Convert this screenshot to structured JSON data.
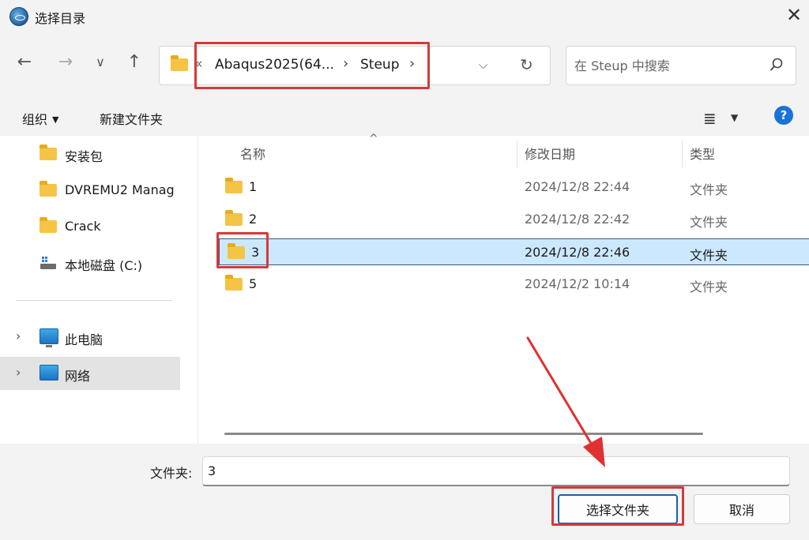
{
  "window": {
    "title": "选择目录",
    "close_glyph": "✕"
  },
  "nav": {
    "back": "←",
    "forward": "→",
    "recent": "∨",
    "up": "↑"
  },
  "address": {
    "overflow": "«",
    "segments": [
      "Abaqus2025(64...",
      "Steup"
    ],
    "separator": "›",
    "dropdown": "⌵",
    "refresh": "↻"
  },
  "search": {
    "placeholder": "在 Steup 中搜索"
  },
  "toolbar": {
    "organize": "组织",
    "organize_arrow": "▼",
    "new_folder": "新建文件夹",
    "view_icon": "≣",
    "view_arrow": "▼",
    "help": "?"
  },
  "sidebar": {
    "items": [
      {
        "label": "安装包",
        "icon": "folder-icon"
      },
      {
        "label": "DVREMU2 Manag",
        "icon": "folder-icon"
      },
      {
        "label": "Crack",
        "icon": "folder-icon"
      },
      {
        "label": "本地磁盘 (C:)",
        "icon": "drive-icon"
      },
      {
        "label": "此电脑",
        "icon": "computer-icon"
      },
      {
        "label": "网络",
        "icon": "network-icon"
      }
    ],
    "expand_glyph": "›"
  },
  "columns": {
    "name": "名称",
    "date": "修改日期",
    "type": "类型",
    "sort_caret": "^"
  },
  "rows": [
    {
      "name": "1",
      "date": "2024/12/8 22:44",
      "type": "文件夹"
    },
    {
      "name": "2",
      "date": "2024/12/8 22:42",
      "type": "文件夹"
    },
    {
      "name": "3",
      "date": "2024/12/8 22:46",
      "type": "文件夹"
    },
    {
      "name": "5",
      "date": "2024/12/2 10:14",
      "type": "文件夹"
    }
  ],
  "bottom": {
    "folder_label": "文件夹:",
    "folder_value": "3"
  },
  "buttons": {
    "select": "选择文件夹",
    "cancel": "取消"
  },
  "colors": {
    "highlight": "#d43a3a",
    "selection": "#cce8ff",
    "folder": "#f5c445",
    "accent": "#1a73d6"
  }
}
